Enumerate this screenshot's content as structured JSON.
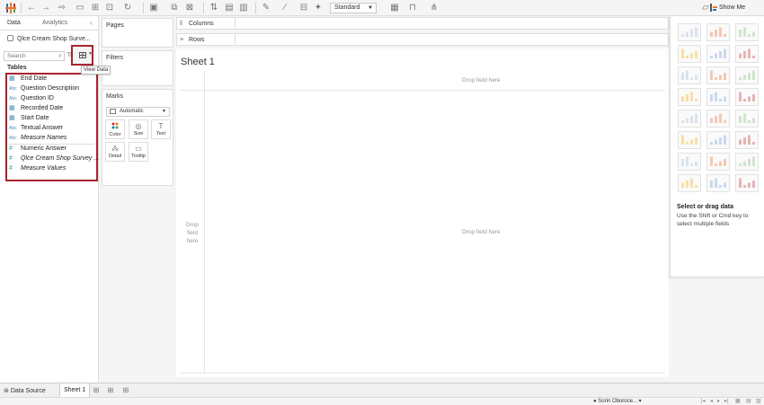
{
  "toolbar": {
    "fit_select": "Standard",
    "show_me_label": "Show Me"
  },
  "data_pane": {
    "tabs": [
      "Data",
      "Analytics"
    ],
    "datasource": "Qlce Cream Shop Surve...",
    "search_placeholder": "Search",
    "view_data_tooltip": "View Data",
    "tables_label": "Tables",
    "fields": [
      {
        "label": "End Date",
        "type": "date",
        "icon": "calendar-icon",
        "italic": false
      },
      {
        "label": "Question Description",
        "type": "string",
        "icon": "abc-icon",
        "italic": false
      },
      {
        "label": "Question ID",
        "type": "string",
        "icon": "abc-icon",
        "italic": false
      },
      {
        "label": "Recorded Date",
        "type": "date",
        "icon": "calendar-icon",
        "italic": false
      },
      {
        "label": "Start Date",
        "type": "date",
        "icon": "calendar-icon",
        "italic": false
      },
      {
        "label": "Textual Answer",
        "type": "string",
        "icon": "abc-icon",
        "italic": false
      },
      {
        "label": "Measure Names",
        "type": "string",
        "icon": "abc-icon",
        "italic": true
      },
      {
        "label": "Numeric Answer",
        "type": "measure",
        "icon": "number-icon",
        "italic": false
      },
      {
        "label": "Qlce Cream Shop Survey ...",
        "type": "measure",
        "icon": "number-icon",
        "italic": true
      },
      {
        "label": "Measure Values",
        "type": "measure",
        "icon": "number-icon",
        "italic": true
      }
    ]
  },
  "cards": {
    "pages": "Pages",
    "filters": "Filters",
    "marks": "Marks",
    "marks_type": "Automatic",
    "mark_buttons": [
      {
        "label": "Color",
        "icon": "color-icon"
      },
      {
        "label": "Size",
        "icon": "size-icon"
      },
      {
        "label": "Text",
        "icon": "text-icon"
      },
      {
        "label": "Detail",
        "icon": "detail-icon"
      },
      {
        "label": "Tooltip",
        "icon": "tooltip-icon"
      }
    ]
  },
  "shelves": {
    "columns": "Columns",
    "rows": "Rows"
  },
  "canvas": {
    "sheet_title": "Sheet 1",
    "drop_top": "Drop field here",
    "drop_main": "Drop field here",
    "drop_left": "Drop field here"
  },
  "show_me": {
    "title": "Select or drag data",
    "hint": "Use the Shift or Cmd key to select multiple fields"
  },
  "bottom": {
    "data_source_tab": "Data Source",
    "sheet_tab": "Sheet 1"
  },
  "status": {
    "user": "Sorin Oboroce..."
  },
  "colors": {
    "highlight": "#a8242f",
    "dimension": "#4a90b8",
    "measure": "#29a19c"
  }
}
